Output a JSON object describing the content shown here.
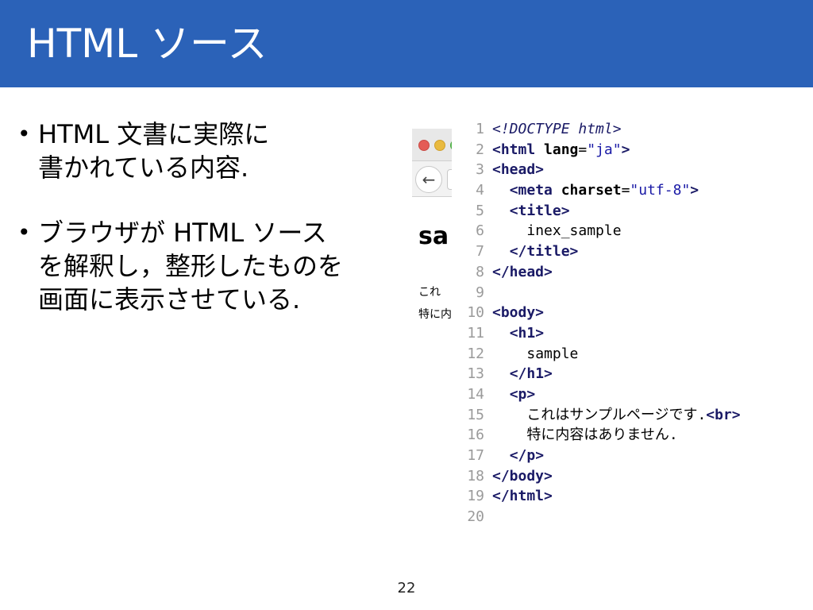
{
  "slide": {
    "title": "HTML ソース",
    "page_number": "22"
  },
  "bullets": [
    {
      "text": "HTML 文書に実際に\n書かれている内容."
    },
    {
      "text": "ブラウザが HTML ソース\nを解釈し，整形したものを\n画面に表示させている."
    }
  ],
  "preview": {
    "heading": "sa",
    "line1": "これ",
    "line2": "特に内"
  },
  "code": {
    "lines": [
      {
        "n": "1",
        "indent": "",
        "tokens": [
          [
            "doc",
            "<!DOCTYPE html>"
          ]
        ]
      },
      {
        "n": "2",
        "indent": "",
        "tokens": [
          [
            "tag",
            "<html"
          ],
          [
            "text",
            " "
          ],
          [
            "attr",
            "lang"
          ],
          [
            "text",
            "="
          ],
          [
            "str",
            "\"ja\""
          ],
          [
            "tag",
            ">"
          ]
        ]
      },
      {
        "n": "3",
        "indent": "",
        "tokens": [
          [
            "tag",
            "<head>"
          ]
        ]
      },
      {
        "n": "4",
        "indent": "  ",
        "tokens": [
          [
            "tag",
            "<meta"
          ],
          [
            "text",
            " "
          ],
          [
            "attr",
            "charset"
          ],
          [
            "text",
            "="
          ],
          [
            "str",
            "\"utf-8\""
          ],
          [
            "tag",
            ">"
          ]
        ]
      },
      {
        "n": "5",
        "indent": "  ",
        "tokens": [
          [
            "tag",
            "<title>"
          ]
        ]
      },
      {
        "n": "6",
        "indent": "    ",
        "tokens": [
          [
            "text",
            "inex_sample"
          ]
        ]
      },
      {
        "n": "7",
        "indent": "  ",
        "tokens": [
          [
            "tag",
            "</title>"
          ]
        ]
      },
      {
        "n": "8",
        "indent": "",
        "tokens": [
          [
            "tag",
            "</head>"
          ]
        ]
      },
      {
        "n": "9",
        "indent": "",
        "tokens": []
      },
      {
        "n": "10",
        "indent": "",
        "tokens": [
          [
            "tag",
            "<body>"
          ]
        ]
      },
      {
        "n": "11",
        "indent": "  ",
        "tokens": [
          [
            "tag",
            "<h1>"
          ]
        ]
      },
      {
        "n": "12",
        "indent": "    ",
        "tokens": [
          [
            "text",
            "sample"
          ]
        ]
      },
      {
        "n": "13",
        "indent": "  ",
        "tokens": [
          [
            "tag",
            "</h1>"
          ]
        ]
      },
      {
        "n": "14",
        "indent": "  ",
        "tokens": [
          [
            "tag",
            "<p>"
          ]
        ]
      },
      {
        "n": "15",
        "indent": "    ",
        "tokens": [
          [
            "text",
            "これはサンプルページです."
          ],
          [
            "tag",
            "<br>"
          ]
        ]
      },
      {
        "n": "16",
        "indent": "    ",
        "tokens": [
          [
            "text",
            "特に内容はありません."
          ]
        ]
      },
      {
        "n": "17",
        "indent": "  ",
        "tokens": [
          [
            "tag",
            "</p>"
          ]
        ]
      },
      {
        "n": "18",
        "indent": "",
        "tokens": [
          [
            "tag",
            "</body>"
          ]
        ]
      },
      {
        "n": "19",
        "indent": "",
        "tokens": [
          [
            "tag",
            "</html>"
          ]
        ]
      },
      {
        "n": "20",
        "indent": "",
        "tokens": []
      }
    ]
  },
  "colors": {
    "header_bg": "#2b62b8",
    "tag": "#1a1a66",
    "string": "#1a1aa6",
    "line_number": "#9a9a9a"
  },
  "icons": {
    "back": "back-arrow-icon"
  }
}
